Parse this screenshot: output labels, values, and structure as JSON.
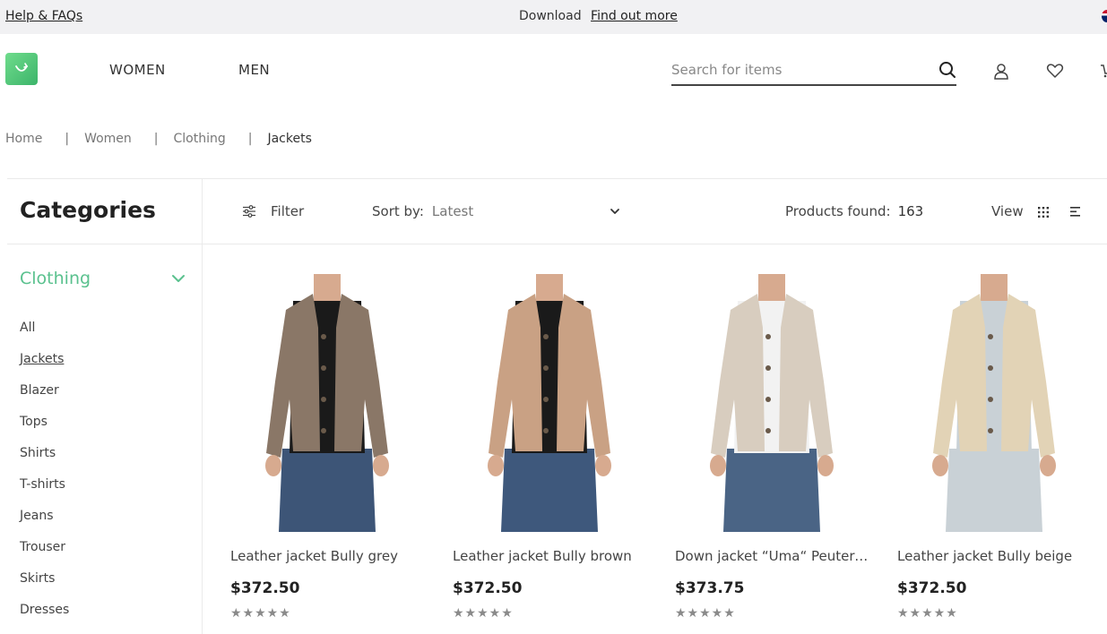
{
  "topbar": {
    "help_label": "Help & FAQs",
    "download_label": "Download",
    "find_out_label": "Find out more"
  },
  "header": {
    "nav": [
      "WOMEN",
      "MEN"
    ],
    "search_placeholder": "Search for items"
  },
  "breadcrumb": [
    "Home",
    "Women",
    "Clothing",
    "Jackets"
  ],
  "sidebar": {
    "title": "Categories",
    "active_group": "Clothing",
    "items": [
      "All",
      "Jackets",
      "Blazer",
      "Tops",
      "Shirts",
      "T-shirts",
      "Jeans",
      "Trouser",
      "Skirts",
      "Dresses"
    ],
    "selected_item": "Jackets"
  },
  "toolbar": {
    "filter_label": "Filter",
    "sort_label": "Sort by:",
    "sort_value": "Latest",
    "products_found_label": "Products found:",
    "products_found_count": "163",
    "view_label": "View"
  },
  "products": [
    {
      "name": "Leather jacket Bully grey",
      "price": "$372.50",
      "rating": 0,
      "jacket_color": "#8a7767",
      "inner_color": "#1a1a1a",
      "jeans_color": "#3d5577"
    },
    {
      "name": "Leather jacket Bully brown",
      "price": "$372.50",
      "rating": 0,
      "jacket_color": "#c9a184",
      "inner_color": "#1a1a1a",
      "jeans_color": "#3e587c"
    },
    {
      "name": "Down jacket “Uma“ Peuterey",
      "price": "$373.75",
      "rating": 0,
      "jacket_color": "#d8cdbf",
      "inner_color": "#f2f2f2",
      "jeans_color": "#4a6485"
    },
    {
      "name": "Leather jacket Bully beige",
      "price": "$372.50",
      "rating": 0,
      "jacket_color": "#e2d3b6",
      "inner_color": "#c9d1d6",
      "jeans_color": "#c9d1d6"
    }
  ],
  "colors": {
    "accent": "#5ac18e",
    "logo": "#4cc474",
    "star": "#8a8a8a"
  }
}
